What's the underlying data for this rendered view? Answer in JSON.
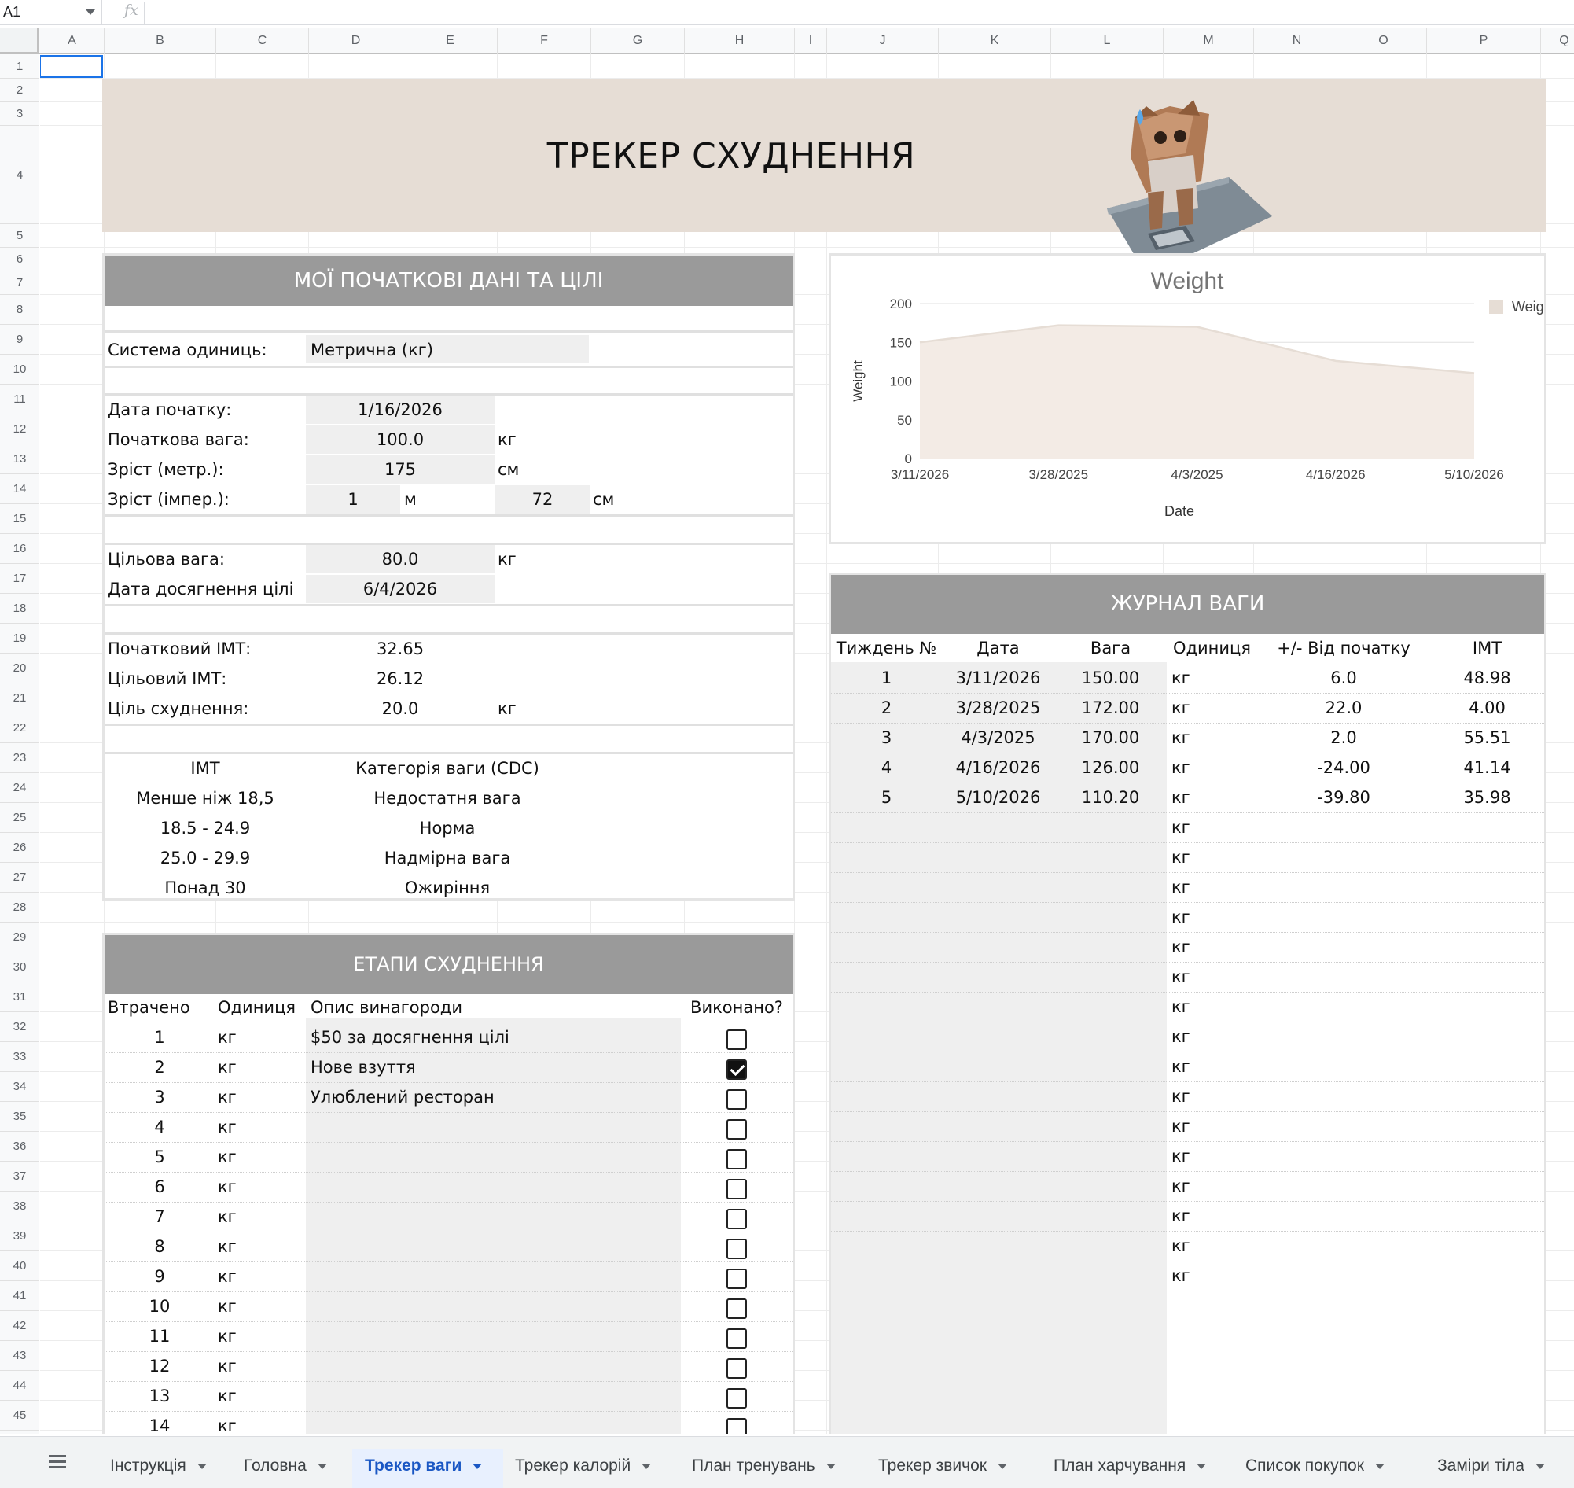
{
  "formula_bar": {
    "cell_ref": "A1",
    "fx_symbol": "fx",
    "value": ""
  },
  "columns": [
    "A",
    "B",
    "C",
    "D",
    "E",
    "F",
    "G",
    "H",
    "I",
    "J",
    "K",
    "L",
    "M",
    "N",
    "O",
    "P",
    "Q"
  ],
  "rows": [
    "1",
    "2",
    "3",
    "4",
    "5",
    "6",
    "7",
    "8",
    "9",
    "10",
    "11",
    "12",
    "13",
    "14",
    "15",
    "16",
    "17",
    "18",
    "19",
    "20",
    "21",
    "22",
    "23",
    "24",
    "25",
    "26",
    "27",
    "28",
    "29",
    "30",
    "31",
    "32",
    "33",
    "34",
    "35",
    "36",
    "37",
    "38",
    "39",
    "40",
    "41",
    "42",
    "43",
    "44",
    "45"
  ],
  "banner": {
    "title": "ТРЕКЕР СХУДНЕННЯ"
  },
  "initial": {
    "header": "МОЇ ПОЧАТКОВІ ДАНІ ТА ЦІЛІ",
    "units_label": "Система одиниць:",
    "units_value": "Метрична (кг)",
    "start_date_label": "Дата початку:",
    "start_date": "1/16/2026",
    "start_weight_label": "Початкова вага:",
    "start_weight": "100.0",
    "kg": "кг",
    "height_metric_label": "Зріст (метр.):",
    "height_metric": "175",
    "cm": "см",
    "height_imp_label": "Зріст (імпер.):",
    "height_imp_m": "1",
    "m": "м",
    "height_imp_cm": "72",
    "target_weight_label": "Цільова вага:",
    "target_weight": "80.0",
    "goal_date_label": "Дата досягнення цілі",
    "goal_date": "6/4/2026",
    "start_bmi_label": "Початковий ІМТ:",
    "start_bmi": "32.65",
    "target_bmi_label": "Цільовий ІМТ:",
    "target_bmi": "26.12",
    "loss_goal_label": "Ціль схуднення:",
    "loss_goal": "20.0",
    "bmi_table": {
      "h_bmi": "ІМТ",
      "h_cat": "Категорія ваги (CDC)",
      "rows": [
        {
          "bmi": "Менше ніж 18,5",
          "cat": "Недостатня вага"
        },
        {
          "bmi": "18.5 - 24.9",
          "cat": "Норма"
        },
        {
          "bmi": "25.0 - 29.9",
          "cat": "Надмірна вага"
        },
        {
          "bmi": "Понад 30",
          "cat": "Ожиріння"
        }
      ]
    }
  },
  "milestones": {
    "header": "ЕТАПИ СХУДНЕННЯ",
    "h_lost": "Втрачено",
    "h_unit": "Одиниця",
    "h_reward": "Опис винагороди",
    "h_done": "Виконано?",
    "rows": [
      {
        "lost": "1",
        "unit": "кг",
        "reward": "$50 за досягнення цілі",
        "done": false
      },
      {
        "lost": "2",
        "unit": "кг",
        "reward": "Нове взуття",
        "done": true
      },
      {
        "lost": "3",
        "unit": "кг",
        "reward": "Улюблений ресторан",
        "done": false
      },
      {
        "lost": "4",
        "unit": "кг",
        "reward": "",
        "done": false
      },
      {
        "lost": "5",
        "unit": "кг",
        "reward": "",
        "done": false
      },
      {
        "lost": "6",
        "unit": "кг",
        "reward": "",
        "done": false
      },
      {
        "lost": "7",
        "unit": "кг",
        "reward": "",
        "done": false
      },
      {
        "lost": "8",
        "unit": "кг",
        "reward": "",
        "done": false
      },
      {
        "lost": "9",
        "unit": "кг",
        "reward": "",
        "done": false
      },
      {
        "lost": "10",
        "unit": "кг",
        "reward": "",
        "done": false
      },
      {
        "lost": "11",
        "unit": "кг",
        "reward": "",
        "done": false
      },
      {
        "lost": "12",
        "unit": "кг",
        "reward": "",
        "done": false
      },
      {
        "lost": "13",
        "unit": "кг",
        "reward": "",
        "done": false
      },
      {
        "lost": "14",
        "unit": "кг",
        "reward": "",
        "done": false
      }
    ]
  },
  "chart_data": {
    "type": "area",
    "title": "Weight",
    "xlabel": "Date",
    "ylabel": "Weight",
    "x": [
      "3/11/2026",
      "3/28/2025",
      "4/3/2025",
      "4/16/2026",
      "5/10/2026"
    ],
    "series": [
      {
        "name": "Weight",
        "values": [
          150.0,
          172.0,
          170.0,
          126.0,
          110.2
        ]
      }
    ],
    "ylim": [
      0,
      200
    ],
    "yticks": [
      0,
      50,
      100,
      150,
      200
    ],
    "grid": true,
    "legend": "right",
    "color": "#f3ebe5",
    "line_color": "#e6ddd5"
  },
  "log": {
    "header": "ЖУРНАЛ ВАГИ",
    "h_week": "Тиждень №",
    "h_date": "Дата",
    "h_weight": "Вага",
    "h_unit": "Одиниця",
    "h_delta": "+/- Від початку",
    "h_bmi": "ІМТ",
    "rows": [
      {
        "week": "1",
        "date": "3/11/2026",
        "weight": "150.00",
        "unit": "кг",
        "delta": "6.0",
        "bmi": "48.98"
      },
      {
        "week": "2",
        "date": "3/28/2025",
        "weight": "172.00",
        "unit": "кг",
        "delta": "22.0",
        "bmi": "4.00"
      },
      {
        "week": "3",
        "date": "4/3/2025",
        "weight": "170.00",
        "unit": "кг",
        "delta": "2.0",
        "bmi": "55.51"
      },
      {
        "week": "4",
        "date": "4/16/2026",
        "weight": "126.00",
        "unit": "кг",
        "delta": "-24.00",
        "bmi": "41.14"
      },
      {
        "week": "5",
        "date": "5/10/2026",
        "weight": "110.20",
        "unit": "кг",
        "delta": "-39.80",
        "bmi": "35.98"
      },
      {
        "week": "",
        "date": "",
        "weight": "",
        "unit": "кг",
        "delta": "",
        "bmi": ""
      },
      {
        "week": "",
        "date": "",
        "weight": "",
        "unit": "кг",
        "delta": "",
        "bmi": ""
      },
      {
        "week": "",
        "date": "",
        "weight": "",
        "unit": "кг",
        "delta": "",
        "bmi": ""
      },
      {
        "week": "",
        "date": "",
        "weight": "",
        "unit": "кг",
        "delta": "",
        "bmi": ""
      },
      {
        "week": "",
        "date": "",
        "weight": "",
        "unit": "кг",
        "delta": "",
        "bmi": ""
      },
      {
        "week": "",
        "date": "",
        "weight": "",
        "unit": "кг",
        "delta": "",
        "bmi": ""
      },
      {
        "week": "",
        "date": "",
        "weight": "",
        "unit": "кг",
        "delta": "",
        "bmi": ""
      },
      {
        "week": "",
        "date": "",
        "weight": "",
        "unit": "кг",
        "delta": "",
        "bmi": ""
      },
      {
        "week": "",
        "date": "",
        "weight": "",
        "unit": "кг",
        "delta": "",
        "bmi": ""
      },
      {
        "week": "",
        "date": "",
        "weight": "",
        "unit": "кг",
        "delta": "",
        "bmi": ""
      },
      {
        "week": "",
        "date": "",
        "weight": "",
        "unit": "кг",
        "delta": "",
        "bmi": ""
      },
      {
        "week": "",
        "date": "",
        "weight": "",
        "unit": "кг",
        "delta": "",
        "bmi": ""
      },
      {
        "week": "",
        "date": "",
        "weight": "",
        "unit": "кг",
        "delta": "",
        "bmi": ""
      },
      {
        "week": "",
        "date": "",
        "weight": "",
        "unit": "кг",
        "delta": "",
        "bmi": ""
      },
      {
        "week": "",
        "date": "",
        "weight": "",
        "unit": "кг",
        "delta": "",
        "bmi": ""
      },
      {
        "week": "",
        "date": "",
        "weight": "",
        "unit": "кг",
        "delta": "",
        "bmi": ""
      }
    ]
  },
  "sheets": [
    {
      "label": "Інструкція",
      "active": false
    },
    {
      "label": "Головна",
      "active": false
    },
    {
      "label": "Трекер ваги",
      "active": true
    },
    {
      "label": "Трекер калорій",
      "active": false
    },
    {
      "label": "План тренувань",
      "active": false
    },
    {
      "label": "Трекер звичок",
      "active": false
    },
    {
      "label": "План харчування",
      "active": false
    },
    {
      "label": "Список покупок",
      "active": false
    },
    {
      "label": "Заміри тіла",
      "active": false
    }
  ]
}
